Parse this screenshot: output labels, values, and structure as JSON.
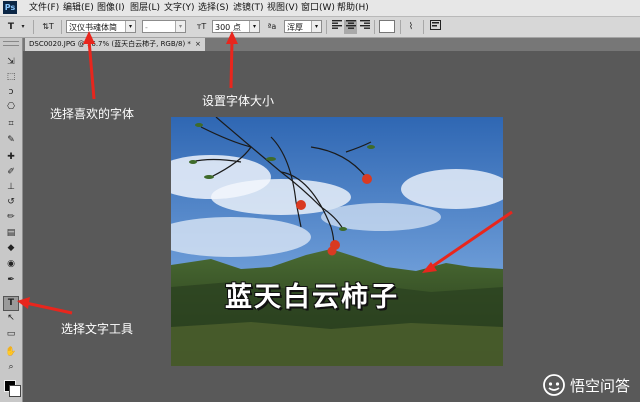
{
  "app": {
    "logo": "Ps"
  },
  "menu": [
    "文件(F)",
    "编辑(E)",
    "图像(I)",
    "图层(L)",
    "文字(Y)",
    "选择(S)",
    "滤镜(T)",
    "视图(V)",
    "窗口(W)",
    "帮助(H)"
  ],
  "options": {
    "tool_glyph": "T",
    "orient_glyph": "⇅T",
    "font_family": "汉仪书魂体简",
    "font_style": "-",
    "size_icon": "тT",
    "font_size": "300 点",
    "aa_label": "ªa",
    "aa_mode": "浑厚",
    "warp_glyph": "⌇"
  },
  "document": {
    "tab_label": "DSC0020.JPG @ 16.7% (蓝天白云柿子, RGB/8) *",
    "close_glyph": "×"
  },
  "tools": [
    "⇲",
    "⬚",
    "ↄ",
    "⎔",
    "⌗",
    "✎",
    "✚",
    "✐",
    "⊥",
    "↺",
    "✏",
    "▤",
    "◆",
    "◉",
    "✒",
    "T",
    "↖",
    "▭",
    "✋",
    "⌕"
  ],
  "annotations": {
    "choose_font": "选择喜欢的字体",
    "set_size": "设置字体大小",
    "choose_tool": "选择文字工具"
  },
  "canvas_text": "蓝天白云柿子",
  "watermark": {
    "text": "悟空问答"
  },
  "colors": {
    "arrow": "#e8261d",
    "sky": "#4c7fc2",
    "mountain": "#3e5a2c",
    "workspace": "#595959"
  }
}
